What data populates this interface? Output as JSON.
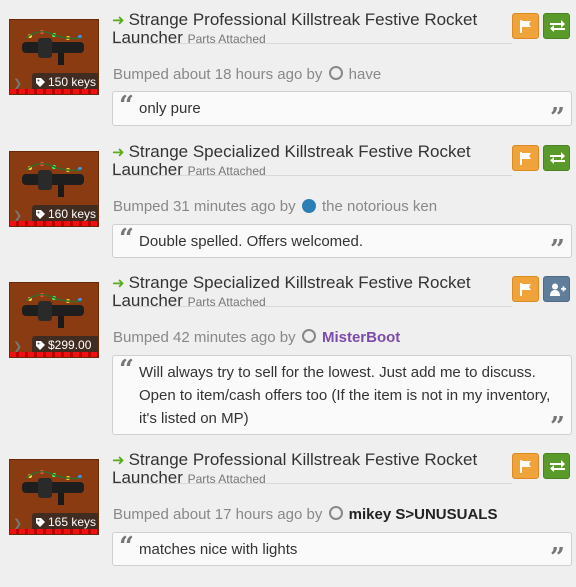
{
  "listings": [
    {
      "title": "Strange Professional Killstreak Festive Rocket Launcher",
      "subtitle": "Parts Attached",
      "price": "150 keys",
      "bump_text": "Bumped about 18 hours ago by",
      "user": "have",
      "comment": "only pure",
      "action_icon": "trade-icon"
    },
    {
      "title": "Strange Specialized Killstreak Festive Rocket Launcher",
      "subtitle": "Parts Attached",
      "price": "160 keys",
      "bump_text": "Bumped 31 minutes ago by",
      "user": "the notorious ken",
      "comment": "Double spelled. Offers welcomed.",
      "action_icon": "trade-icon"
    },
    {
      "title": "Strange Specialized Killstreak Festive Rocket Launcher",
      "subtitle": "Parts Attached",
      "price": "$299.00",
      "bump_text": "Bumped 42 minutes ago by",
      "user": "MisterBoot",
      "comment": "Will always try to sell for the lowest. Just add me to discuss. Open to item/cash offers too (If the item is not in my inventory, it's listed on MP)",
      "action_icon": "add-friend-icon"
    },
    {
      "title": "Strange Professional Killstreak Festive Rocket Launcher",
      "subtitle": "Parts Attached",
      "price": "165 keys",
      "bump_text": "Bumped about 17 hours ago by",
      "user": "mikey S>UNUSUALS",
      "comment": "matches nice with lights",
      "action_icon": "trade-icon"
    }
  ],
  "colors": {
    "flag_button": "#f0a33a",
    "trade_button": "#5a9a2a",
    "add_button": "#607d9a",
    "username_purple": "#7d4ba8",
    "status_dot_blue": "#2b7fb5",
    "title_arrow": "#5cab1c",
    "item_background": "#8a3b12"
  }
}
